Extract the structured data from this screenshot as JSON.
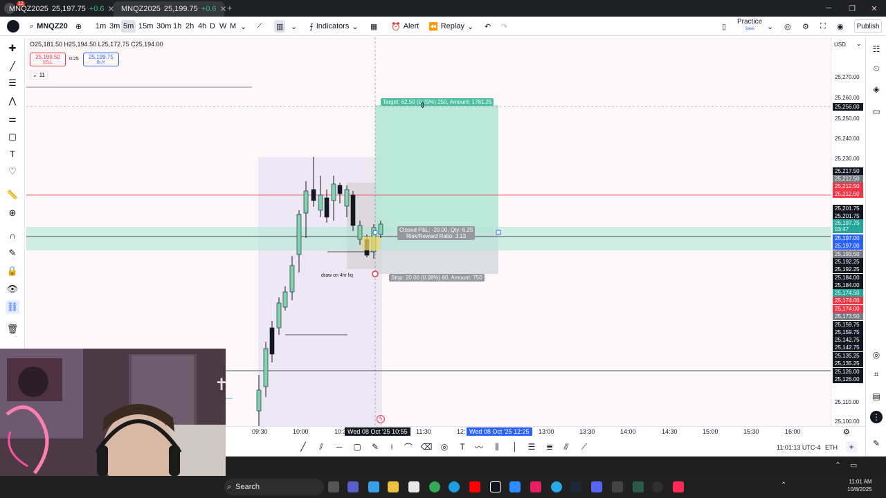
{
  "browser": {
    "tabs": [
      {
        "symbol": "MNQZ2025",
        "price": "25,197.75",
        "change": "+0.6"
      },
      {
        "symbol": "MNQZ2025",
        "price": "25,199.75",
        "change": "+0.6"
      }
    ],
    "new_tab": "+",
    "notification_count": "12"
  },
  "toolbar": {
    "symbol": "MNQZ20",
    "intervals": [
      "1m",
      "3m",
      "5m",
      "15m",
      "30m",
      "1h",
      "2h",
      "4h",
      "D",
      "W",
      "M"
    ],
    "active_interval": "5m",
    "indicators_label": "Indicators",
    "alert_label": "Alert",
    "replay_label": "Replay",
    "practice_label": "Practice",
    "practice_sub": "Save",
    "publish_label": "Publish"
  },
  "chart": {
    "ohlc": "O25,181.50 H25,194.50 L25,172.75 C25,194.00",
    "sell": {
      "price": "25,199.50",
      "label": "SELL"
    },
    "buy": {
      "price": "25,199.75",
      "label": "BUY"
    },
    "spread": "0.25",
    "collapse_count": "11",
    "currency": "USD",
    "target_text": "Target: 62.50 (0.25%) 250, Amount: 1781.25",
    "pnl_line1": "Closed P&L: -20.00, Qty: 6.25",
    "pnl_line2": "Risk/Reward Ratio: 3.13",
    "stop_text": "Stop: 20.00 (0.08%) 80, Amount: 750",
    "annotation": "draw on 4hr liq",
    "price_labels": [
      {
        "text": "25,270.00",
        "kind": "plain"
      },
      {
        "text": "25,260.00",
        "kind": "plain"
      },
      {
        "text": "25,256.00",
        "kind": "crosshair"
      },
      {
        "text": "25,250.00",
        "kind": "plain"
      },
      {
        "text": "25,240.00",
        "kind": "plain"
      },
      {
        "text": "25,230.00",
        "kind": "plain"
      },
      {
        "text": "25,217.50",
        "kind": "black"
      },
      {
        "text": "25,212.50",
        "kind": "gray"
      },
      {
        "text": "25,212.50",
        "kind": "red"
      },
      {
        "text": "25,212.50",
        "kind": "red"
      },
      {
        "text": "25,201.75",
        "kind": "black"
      },
      {
        "text": "25,201.75",
        "kind": "black"
      },
      {
        "text": "25,197.75",
        "kind": "green"
      },
      {
        "text": "03:47",
        "kind": "green"
      },
      {
        "text": "25,197.00",
        "kind": "blue"
      },
      {
        "text": "25,197.00",
        "kind": "blue"
      },
      {
        "text": "25,193.50",
        "kind": "gray"
      },
      {
        "text": "25,192.25",
        "kind": "black"
      },
      {
        "text": "25,192.25",
        "kind": "black"
      },
      {
        "text": "25,184.00",
        "kind": "black"
      },
      {
        "text": "25,184.00",
        "kind": "black"
      },
      {
        "text": "25,174.50",
        "kind": "green"
      },
      {
        "text": "25,174.00",
        "kind": "red"
      },
      {
        "text": "25,174.00",
        "kind": "red"
      },
      {
        "text": "25,173.50",
        "kind": "gray"
      },
      {
        "text": "25,159.75",
        "kind": "black"
      },
      {
        "text": "25,159.75",
        "kind": "black"
      },
      {
        "text": "25,142.75",
        "kind": "black"
      },
      {
        "text": "25,142.75",
        "kind": "black"
      },
      {
        "text": "25,135.25",
        "kind": "black"
      },
      {
        "text": "25,135.25",
        "kind": "black"
      },
      {
        "text": "25,126.00",
        "kind": "black"
      },
      {
        "text": "25,126.00",
        "kind": "black"
      },
      {
        "text": "25,110.00",
        "kind": "plain"
      },
      {
        "text": "25,100.00",
        "kind": "plain"
      }
    ],
    "time_labels": [
      "09:30",
      "10:00",
      "10:3",
      "11:30",
      "12:",
      "13:00",
      "13:30",
      "14:00",
      "14:30",
      "15:00",
      "15:30",
      "16:00"
    ],
    "time_tag_1": "Wed 08 Oct '25  10:55",
    "time_tag_2": "Wed 08 Oct '25  12:25",
    "clock": "11:01:13 UTC-4",
    "session": "ETH"
  },
  "taskbar": {
    "search_placeholder": "Search",
    "time": "11:01 AM",
    "date": "10/8/2025"
  },
  "colors": {
    "bull": "#26a69a",
    "bear": "#131722",
    "target_zone": "#b2e6d5",
    "stop_zone": "#d1d4dc",
    "accent": "#2962ff",
    "sell": "#f23645"
  }
}
